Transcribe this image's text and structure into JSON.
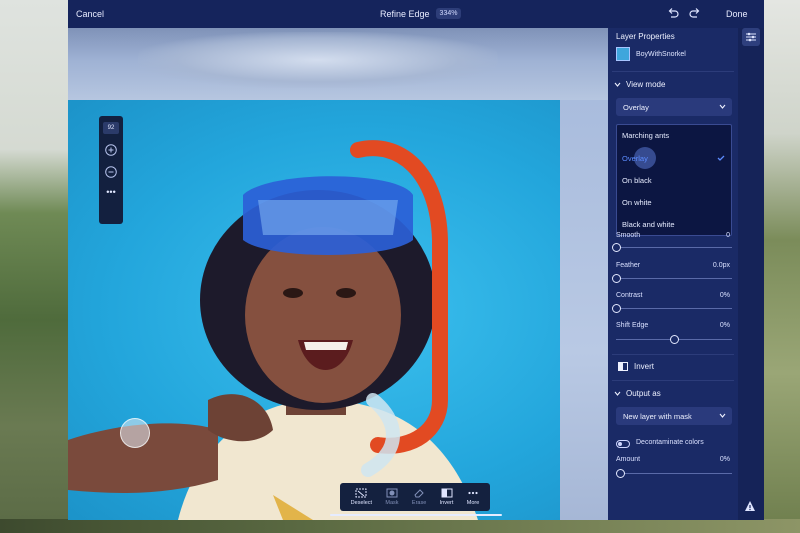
{
  "topbar": {
    "cancel_label": "Cancel",
    "title": "Refine Edge",
    "zoom": "334%",
    "done_label": "Done"
  },
  "mini_toolbar": {
    "brush_size": "92"
  },
  "tools": [
    {
      "label": "Deselect",
      "icon": "deselect-icon",
      "enabled": true
    },
    {
      "label": "Mask",
      "icon": "mask-icon",
      "enabled": false
    },
    {
      "label": "Erase",
      "icon": "erase-icon",
      "enabled": false
    },
    {
      "label": "Invert",
      "icon": "invert-icon",
      "enabled": true
    },
    {
      "label": "More",
      "icon": "more-icon",
      "enabled": true
    }
  ],
  "panel": {
    "header": "Layer Properties",
    "layer_name": "BoyWithSnorkel",
    "view_mode": {
      "label": "View mode",
      "selected": "Overlay",
      "options": [
        "Marching ants",
        "Overlay",
        "On black",
        "On white",
        "Black and white"
      ]
    },
    "sliders": [
      {
        "label": "Smooth",
        "value": "0",
        "fraction": 0.0
      },
      {
        "label": "Feather",
        "value": "0.0px",
        "fraction": 0.0
      },
      {
        "label": "Contrast",
        "value": "0%",
        "fraction": 0.0
      },
      {
        "label": "Shift Edge",
        "value": "0%",
        "fraction": 0.5
      }
    ],
    "invert_label": "Invert",
    "output": {
      "label": "Output as",
      "selected": "New layer with mask"
    },
    "decontaminate_label": "Decontaminate colors",
    "amount": {
      "label": "Amount",
      "value": "0%",
      "fraction": 0.0
    }
  },
  "colors": {
    "panel_bg": "#1a2a66",
    "accent_blue": "#5c8cff",
    "photo_bg": "#29aee3"
  }
}
